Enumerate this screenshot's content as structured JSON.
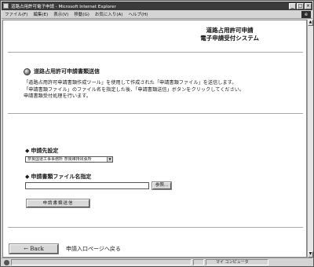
{
  "window": {
    "title": "道路占用許可電子申請 - Microsoft Internet Explorer",
    "controls": [
      "_",
      "□",
      "×"
    ]
  },
  "menu": {
    "items": [
      "ファイル(F)",
      "編集(E)",
      "表示(V)",
      "移動(G)",
      "お気に入り(A)",
      "ヘルプ(H)"
    ]
  },
  "page": {
    "header_line1": "道路占用許可申請",
    "header_line2": "電子申請受付システム",
    "section_title": "道路占用許可申請書類送信",
    "description": [
      "「道路占用許可申請書類作成ツール」を使用して作成された「申請書類ファイル」を送信します。",
      "「申請書類ファイル」のファイル名を指定した後、「申請書類送信」ボタンをクリックしてください。",
      "申請書類受付処理を行います。"
    ],
    "dest_label": "申請先設定",
    "dest_selected": "奈良国道工事事務所 奈良維持出張所",
    "file_label": "申請書類ファイル名指定",
    "file_value": "",
    "browse_label": "参照...",
    "submit_label": "申請書類送信",
    "back_label": "← Back",
    "back_text": "申請入口ページへ戻る"
  },
  "statusbar": {
    "zone": "マイ コンピュータ"
  }
}
